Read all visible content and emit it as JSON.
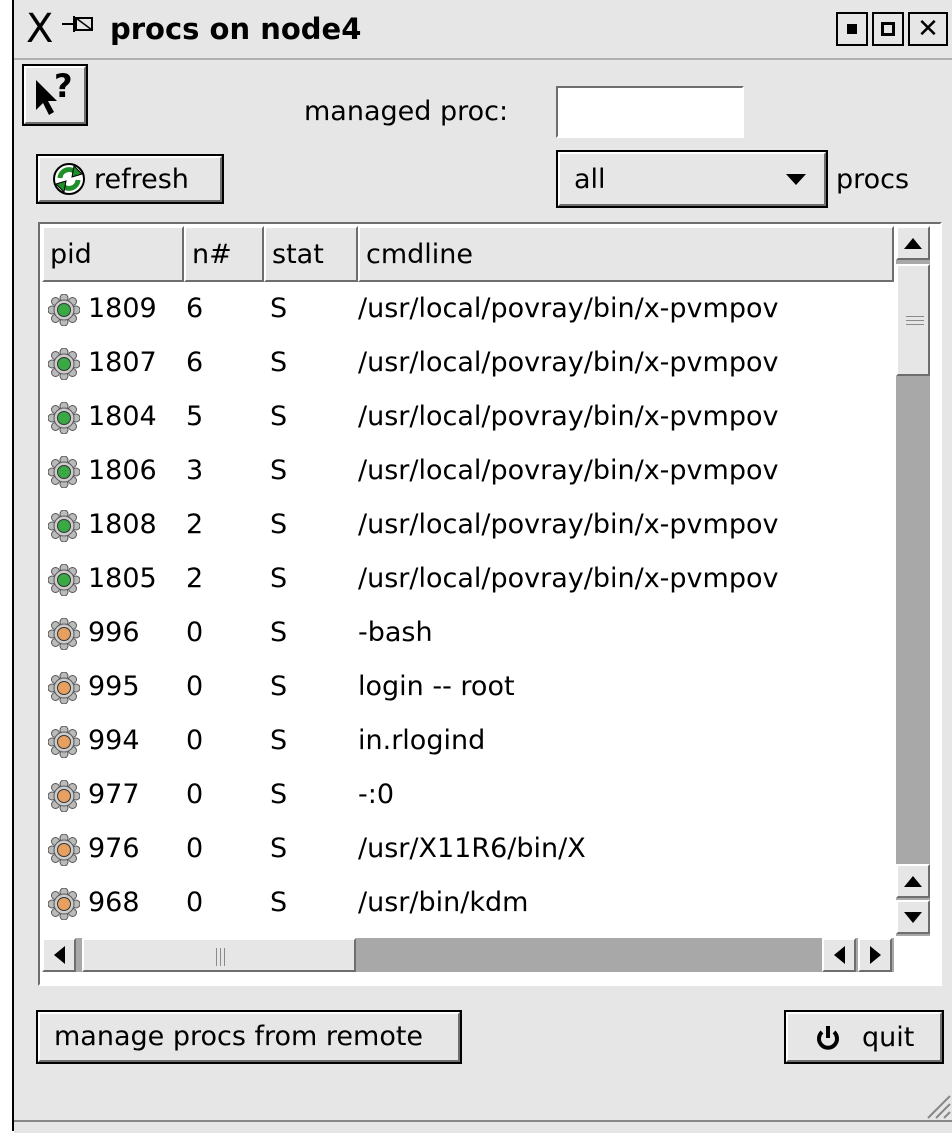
{
  "window": {
    "title": "procs on node4",
    "x_glyph": "X",
    "pin_glyph": "⊣⊠"
  },
  "toolbar": {
    "help_icon": "whats-this-icon",
    "help_glyph": "?",
    "managed_proc_label": "managed proc:",
    "managed_proc_value": "",
    "refresh_label": "refresh",
    "filter_value": "all",
    "filter_suffix": "procs"
  },
  "table": {
    "columns": [
      "pid",
      "n#",
      "stat",
      "cmdline"
    ],
    "rows": [
      {
        "pid": "1809",
        "n": "6",
        "stat": "S",
        "cmdline": "/usr/local/povray/bin/x-pvmpov",
        "state": "managed"
      },
      {
        "pid": "1807",
        "n": "6",
        "stat": "S",
        "cmdline": "/usr/local/povray/bin/x-pvmpov",
        "state": "managed"
      },
      {
        "pid": "1804",
        "n": "5",
        "stat": "S",
        "cmdline": "/usr/local/povray/bin/x-pvmpov",
        "state": "managed"
      },
      {
        "pid": "1806",
        "n": "3",
        "stat": "S",
        "cmdline": "/usr/local/povray/bin/x-pvmpov",
        "state": "managed"
      },
      {
        "pid": "1808",
        "n": "2",
        "stat": "S",
        "cmdline": "/usr/local/povray/bin/x-pvmpov",
        "state": "managed"
      },
      {
        "pid": "1805",
        "n": "2",
        "stat": "S",
        "cmdline": "/usr/local/povray/bin/x-pvmpov",
        "state": "managed"
      },
      {
        "pid": "996",
        "n": "0",
        "stat": "S",
        "cmdline": "-bash",
        "state": "local"
      },
      {
        "pid": "995",
        "n": "0",
        "stat": "S",
        "cmdline": "login -- root",
        "state": "local"
      },
      {
        "pid": "994",
        "n": "0",
        "stat": "S",
        "cmdline": "in.rlogind",
        "state": "local"
      },
      {
        "pid": "977",
        "n": "0",
        "stat": "S",
        "cmdline": "-:0",
        "state": "local"
      },
      {
        "pid": "976",
        "n": "0",
        "stat": "S",
        "cmdline": "/usr/X11R6/bin/X",
        "state": "local"
      },
      {
        "pid": "968",
        "n": "0",
        "stat": "S",
        "cmdline": "/usr/bin/kdm",
        "state": "local"
      },
      {
        "pid": "",
        "n": "",
        "stat": "",
        "cmdline": "",
        "state": "local"
      }
    ]
  },
  "footer": {
    "manage_remote_label": "manage procs from remote",
    "quit_label": "quit"
  },
  "colors": {
    "chrome": "#e6e6e6",
    "managed_gear": "#3aa845",
    "local_gear": "#e8a060",
    "scroll_trough": "#a8a8a8"
  }
}
